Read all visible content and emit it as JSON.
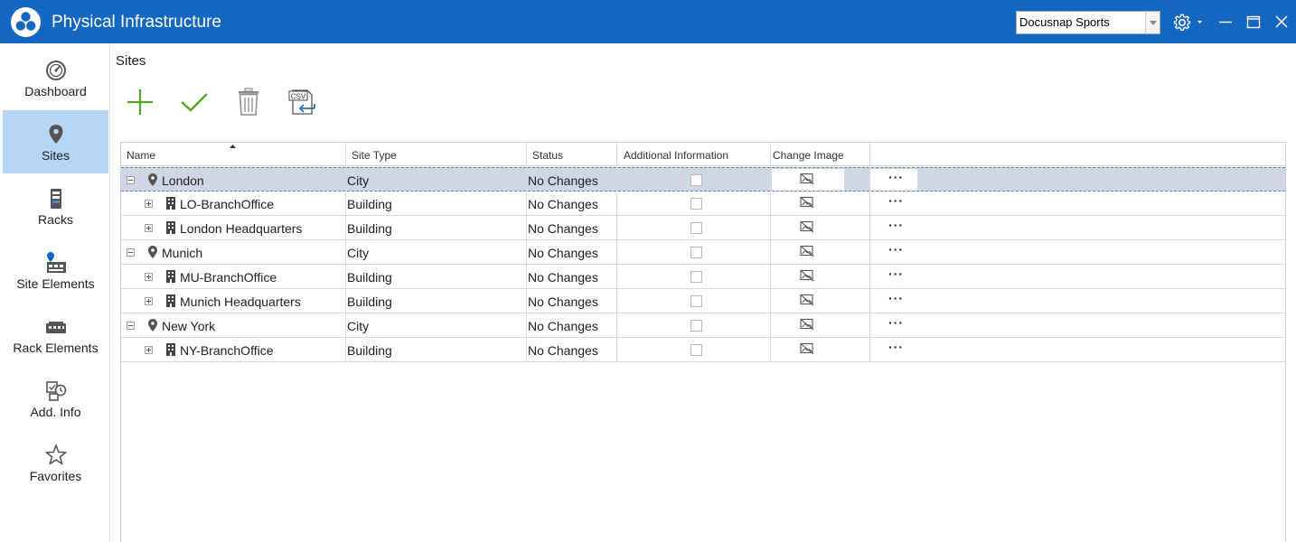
{
  "window": {
    "title": "Physical Infrastructure",
    "workspace_selected": "Docusnap Sports",
    "accent_color": "#1467c0"
  },
  "sidebar": {
    "items": [
      {
        "label": "Dashboard",
        "icon": "dashboard-icon",
        "active": false
      },
      {
        "label": "Sites",
        "icon": "location-pin-icon",
        "active": true
      },
      {
        "label": "Racks",
        "icon": "rack-icon",
        "active": false
      },
      {
        "label": "Site Elements",
        "icon": "site-elements-icon",
        "active": false
      },
      {
        "label": "Rack Elements",
        "icon": "rack-elements-icon",
        "active": false
      },
      {
        "label": "Add. Info",
        "icon": "additional-info-icon",
        "active": false
      },
      {
        "label": "Favorites",
        "icon": "star-icon",
        "active": false
      }
    ]
  },
  "main": {
    "title": "Sites",
    "toolbar": [
      "add-icon",
      "save-check-icon",
      "delete-trash-icon",
      "csv-import-icon"
    ]
  },
  "grid": {
    "columns": [
      "Name",
      "Site Type",
      "Status",
      "Additional Information",
      "Change Image",
      ""
    ],
    "rows": [
      {
        "name": "London",
        "type": "City",
        "status": "No Changes",
        "level": 0,
        "expanded": true,
        "selected": true
      },
      {
        "name": "LO-BranchOffice",
        "type": "Building",
        "status": "No Changes",
        "level": 1,
        "expanded": false,
        "selected": false
      },
      {
        "name": "London Headquarters",
        "type": "Building",
        "status": "No Changes",
        "level": 1,
        "expanded": false,
        "selected": false
      },
      {
        "name": "Munich",
        "type": "City",
        "status": "No Changes",
        "level": 0,
        "expanded": true,
        "selected": false
      },
      {
        "name": "MU-BranchOffice",
        "type": "Building",
        "status": "No Changes",
        "level": 1,
        "expanded": false,
        "selected": false
      },
      {
        "name": "Munich Headquarters",
        "type": "Building",
        "status": "No Changes",
        "level": 1,
        "expanded": false,
        "selected": false
      },
      {
        "name": "New York",
        "type": "City",
        "status": "No Changes",
        "level": 0,
        "expanded": true,
        "selected": false
      },
      {
        "name": "NY-BranchOffice",
        "type": "Building",
        "status": "No Changes",
        "level": 1,
        "expanded": false,
        "selected": false
      }
    ],
    "more_label": "···"
  }
}
